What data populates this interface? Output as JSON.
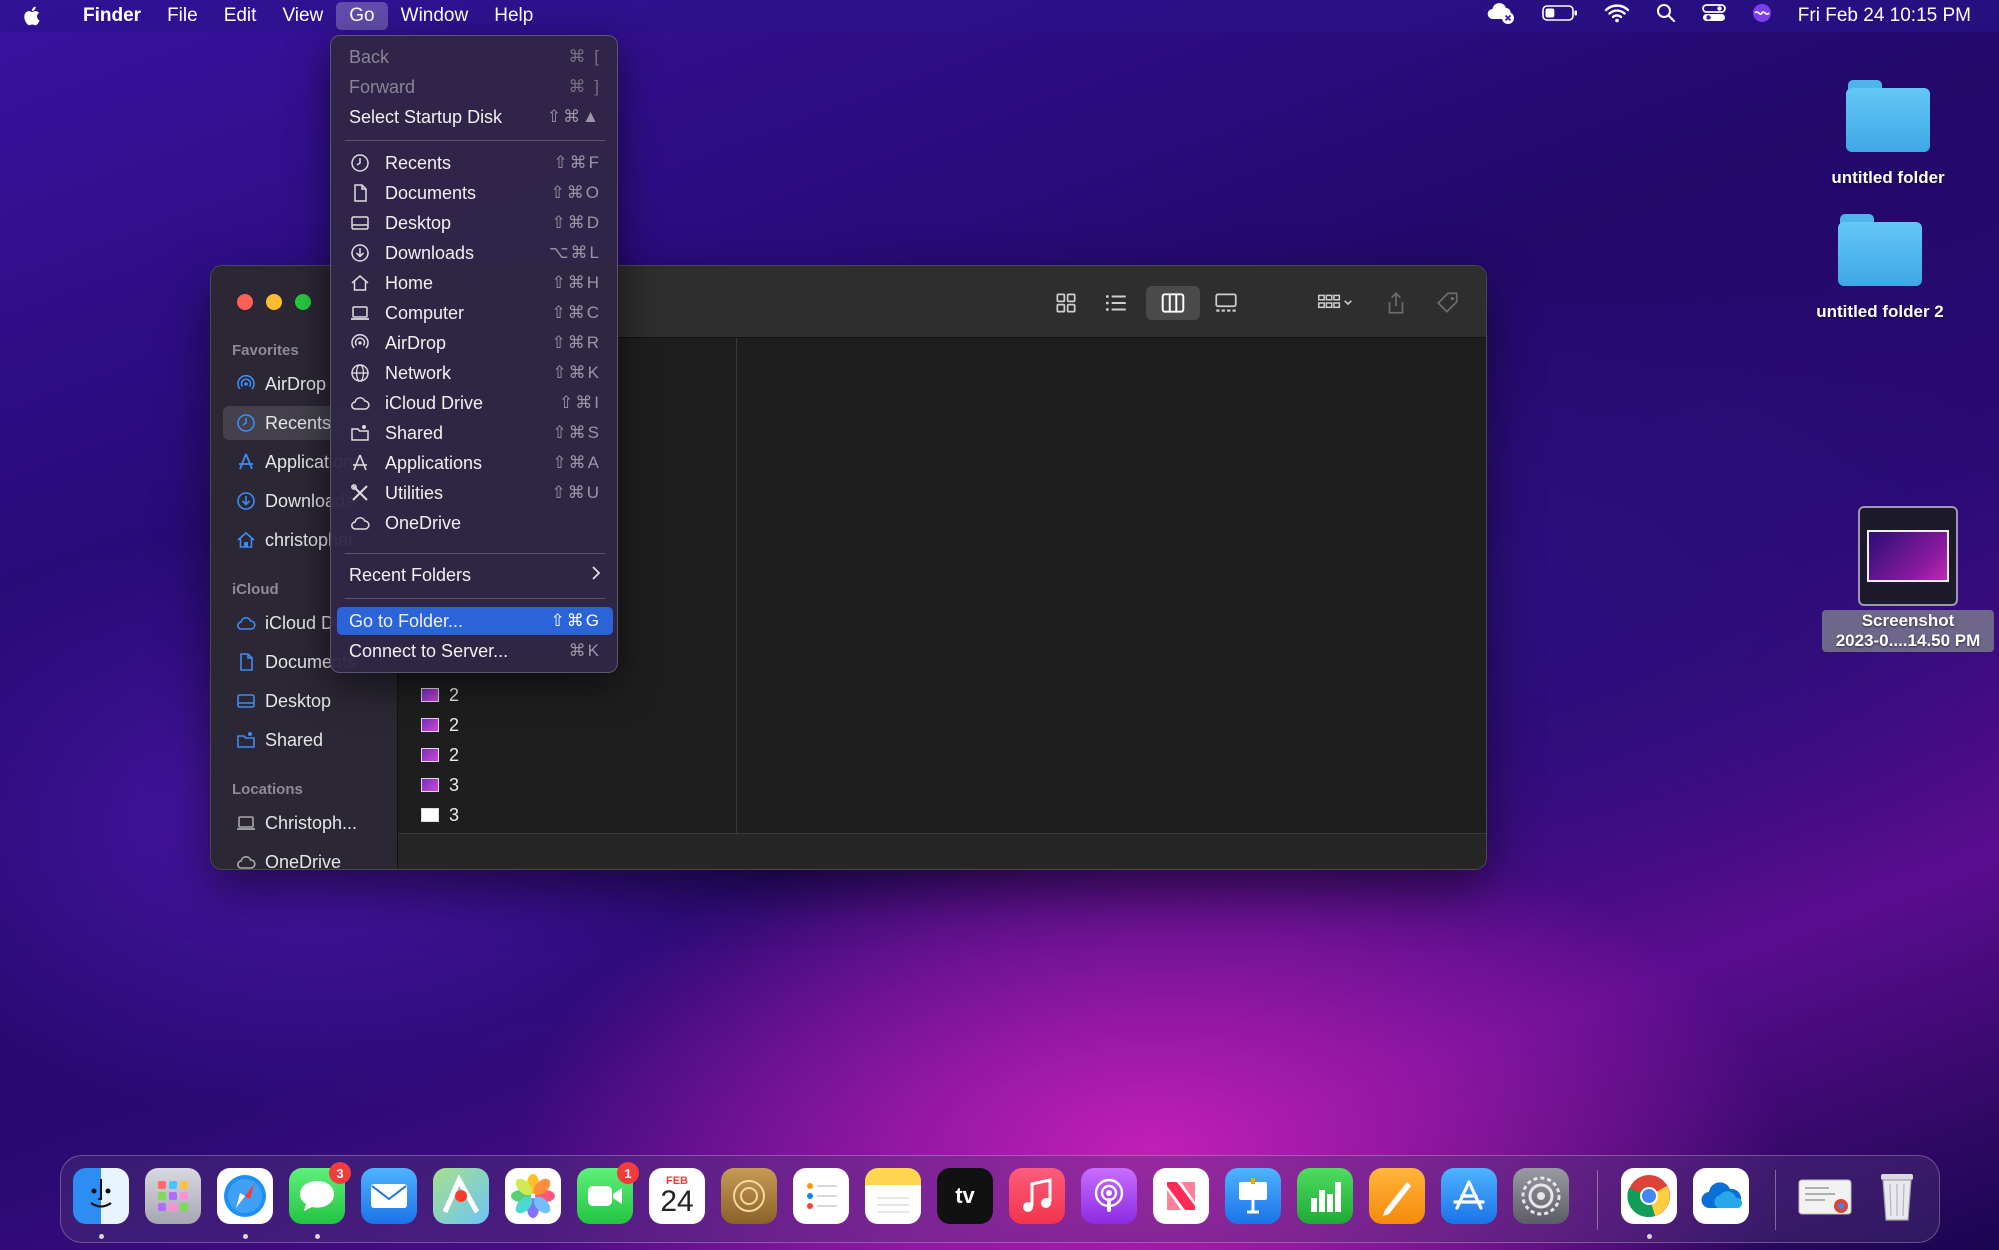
{
  "menubar": {
    "app": "Finder",
    "items": [
      "File",
      "Edit",
      "View",
      "Go",
      "Window",
      "Help"
    ],
    "clock": "Fri Feb 24  10:15 PM",
    "battery_level": 0.35
  },
  "desktop": {
    "folder1": "untitled folder",
    "folder2": "untitled folder 2",
    "screenshot_line1": "Screenshot",
    "screenshot_line2": "2023-0....14.50 PM"
  },
  "sidebar": {
    "favorites_label": "Favorites",
    "icloud_label": "iCloud",
    "locations_label": "Locations",
    "items": [
      {
        "label": "AirDrop",
        "icon": "airdrop-icon"
      },
      {
        "label": "Recents",
        "icon": "clock-icon"
      },
      {
        "label": "Applications",
        "icon": "applications-icon"
      },
      {
        "label": "Downloads",
        "icon": "download-icon"
      },
      {
        "label": "christopher",
        "icon": "home-icon"
      },
      {
        "label": "iCloud Drive",
        "icon": "cloud-icon"
      },
      {
        "label": "Documents",
        "icon": "document-icon"
      },
      {
        "label": "Desktop",
        "icon": "desktop-icon"
      },
      {
        "label": "Shared",
        "icon": "shared-folder-icon"
      },
      {
        "label": "Christoph...",
        "icon": "laptop-icon"
      },
      {
        "label": "OneDrive",
        "icon": "cloud-icon"
      }
    ]
  },
  "files": [
    "2",
    "2",
    "2",
    "3",
    "3"
  ],
  "gomenu": {
    "back": {
      "label": "Back",
      "shortcut": "⌘ ["
    },
    "forward": {
      "label": "Forward",
      "shortcut": "⌘ ]"
    },
    "startup": {
      "label": "Select Startup Disk",
      "shortcut": "⇧⌘▲"
    },
    "places": [
      {
        "label": "Recents",
        "shortcut": "⇧⌘F",
        "icon": "clock-icon"
      },
      {
        "label": "Documents",
        "shortcut": "⇧⌘O",
        "icon": "document-icon"
      },
      {
        "label": "Desktop",
        "shortcut": "⇧⌘D",
        "icon": "desktop-icon"
      },
      {
        "label": "Downloads",
        "shortcut": "⌥⌘L",
        "icon": "download-icon"
      },
      {
        "label": "Home",
        "shortcut": "⇧⌘H",
        "icon": "home-icon"
      },
      {
        "label": "Computer",
        "shortcut": "⇧⌘C",
        "icon": "laptop-icon"
      },
      {
        "label": "AirDrop",
        "shortcut": "⇧⌘R",
        "icon": "airdrop-icon"
      },
      {
        "label": "Network",
        "shortcut": "⇧⌘K",
        "icon": "globe-icon"
      },
      {
        "label": "iCloud Drive",
        "shortcut": "⇧⌘I",
        "icon": "cloud-icon"
      },
      {
        "label": "Shared",
        "shortcut": "⇧⌘S",
        "icon": "shared-folder-icon"
      },
      {
        "label": "Applications",
        "shortcut": "⇧⌘A",
        "icon": "applications-icon"
      },
      {
        "label": "Utilities",
        "shortcut": "⇧⌘U",
        "icon": "utilities-icon"
      },
      {
        "label": "OneDrive",
        "shortcut": "",
        "icon": "cloud-icon"
      }
    ],
    "recent_folders": "Recent Folders",
    "go_to_folder": {
      "label": "Go to Folder...",
      "shortcut": "⇧⌘G"
    },
    "connect": {
      "label": "Connect to Server...",
      "shortcut": "⌘K"
    }
  },
  "dock": {
    "messages_badge": "3",
    "facetime_badge": "1",
    "calendar_month": "FEB",
    "calendar_day": "24",
    "tv_label": "tv"
  }
}
